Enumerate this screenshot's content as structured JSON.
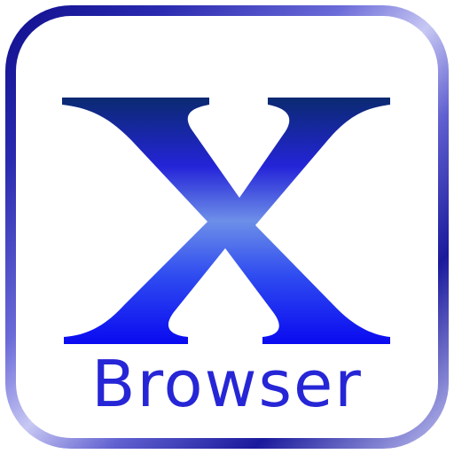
{
  "app": {
    "logo_letter": "X",
    "label": "Browser",
    "icon": "x-browser-logo-icon"
  },
  "colors": {
    "label": "#2626d6",
    "logo_top": "#0a2a70",
    "logo_mid": "#2a2ae0",
    "logo_light": "#6d8fe8",
    "logo_bottom": "#0a0af0",
    "frame_dark": "#0e0e8c",
    "frame_light": "#c8c8f4"
  }
}
